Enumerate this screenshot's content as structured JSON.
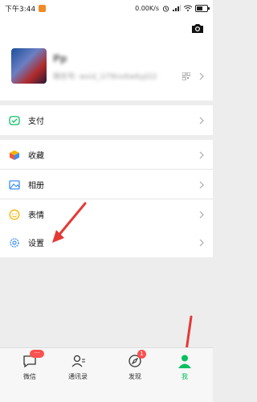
{
  "status_bar": {
    "time": "下午3:44",
    "speed": "0.00K/s",
    "battery_level": 0.6
  },
  "profile": {
    "name": "Pp",
    "wechat_id": "微信号: wxid_1l78nx6w6yjl22"
  },
  "menu": {
    "pay": "支付",
    "favorites": "收藏",
    "album": "相册",
    "stickers": "表情",
    "settings": "设置"
  },
  "tabs": {
    "chats": {
      "label": "微信",
      "badge": "···"
    },
    "contacts": {
      "label": "通讯录"
    },
    "discover": {
      "label": "发现",
      "badge": "1"
    },
    "me": {
      "label": "我"
    }
  },
  "colors": {
    "accent": "#07c160",
    "badge": "#fa5151",
    "annotation_arrow": "#e53935"
  }
}
